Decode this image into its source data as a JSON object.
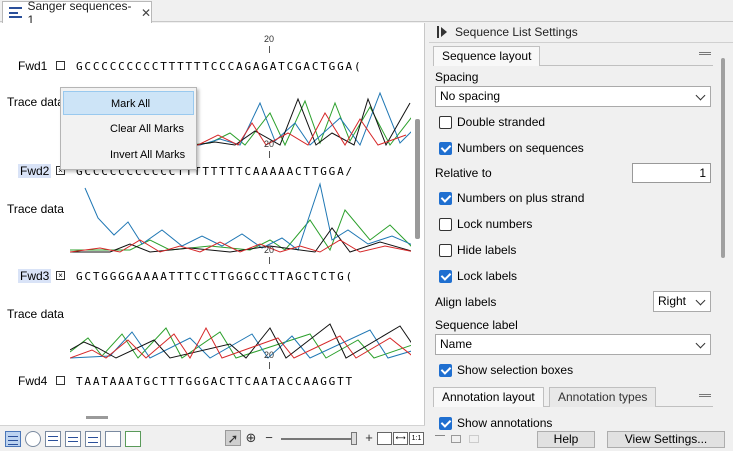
{
  "tab": {
    "title": "Sanger sequences-1",
    "close": "✕",
    "icon": "sequence-list-icon"
  },
  "sequences": [
    {
      "name": "Fwd1",
      "marked": false,
      "bases": "GCCCCCCCCCTTTTTTCCCAGAGATCGACTGGA(",
      "ruler": "20",
      "trace_label": "Trace data"
    },
    {
      "name": "Fwd2",
      "marked": true,
      "bases": "GCCCCCCCCCCCTTTTTTTTCAAAAACTTGGA/",
      "ruler": "20",
      "trace_label": "Trace data"
    },
    {
      "name": "Fwd3",
      "marked": true,
      "bases": "GCTGGGGAAAATTTCCTTGGGCCTTAGCTCTG(",
      "ruler": "20",
      "trace_label": "Trace data"
    },
    {
      "name": "Fwd4",
      "marked": false,
      "bases": "TAATAAATGCTTTGGGACTTCAATACCAAGGTT",
      "ruler": "20"
    }
  ],
  "context_menu": {
    "items": [
      "Mark All",
      "Clear All Marks",
      "Invert All Marks"
    ],
    "highlighted": 0
  },
  "panel": {
    "title": "Sequence List Settings",
    "layout_tab": "Sequence layout",
    "spacing_label": "Spacing",
    "spacing_value": "No spacing",
    "double_stranded": "Double stranded",
    "numbers_on_sequences": "Numbers on sequences",
    "relative_to_label": "Relative to",
    "relative_to_value": "1",
    "numbers_on_plus_strand": "Numbers on plus strand",
    "lock_numbers": "Lock numbers",
    "hide_labels": "Hide labels",
    "lock_labels": "Lock labels",
    "align_labels_label": "Align labels",
    "align_labels_value": "Right",
    "sequence_label_label": "Sequence label",
    "sequence_label_value": "Name",
    "show_selection_boxes": "Show selection boxes",
    "annotation_layout_tab": "Annotation layout",
    "annotation_types_tab": "Annotation types",
    "show_annotations": "Show annotations",
    "help_button": "Help",
    "view_settings_button": "View Settings..."
  },
  "checks": {
    "double_stranded": false,
    "numbers_on_sequences": true,
    "numbers_on_plus_strand": true,
    "lock_numbers": false,
    "hide_labels": false,
    "lock_labels": true,
    "show_selection_boxes": true,
    "show_annotations": true
  },
  "zoom": {
    "fit": "⟷",
    "one_to_one": "1:1"
  },
  "colors": {
    "accent": "#1f6fd0",
    "trace_a": "#2ca02c",
    "trace_c": "#1f77b4",
    "trace_g": "#111111",
    "trace_t": "#d62728",
    "menu_highlight": "#cde4f7"
  }
}
